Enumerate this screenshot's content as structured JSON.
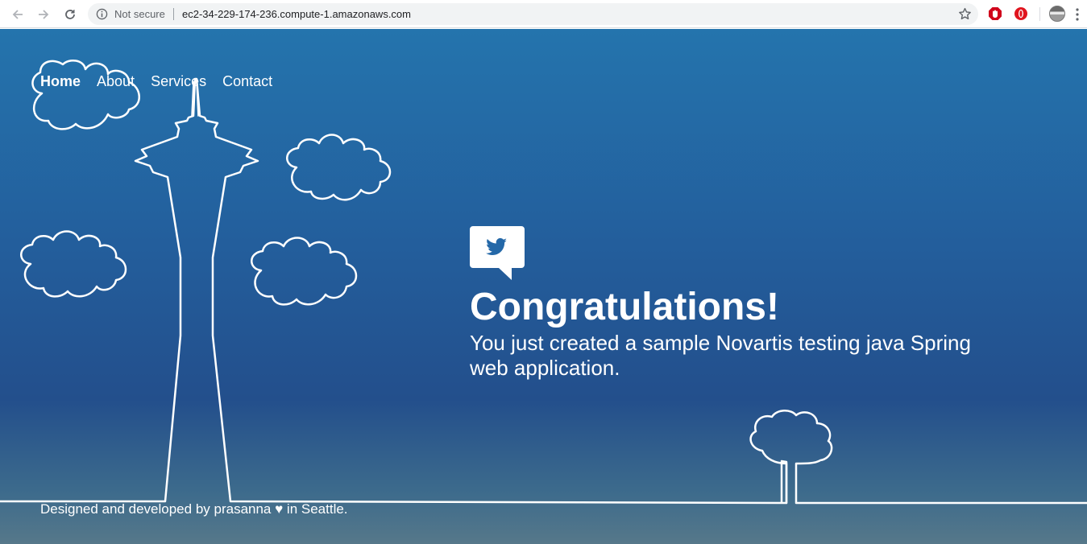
{
  "browser": {
    "security_label": "Not secure",
    "url": "ec2-34-229-174-236.compute-1.amazonaws.com",
    "icons": [
      "back-arrow-icon",
      "forward-arrow-icon",
      "reload-icon",
      "info-icon",
      "star-icon",
      "extension-stop-icon",
      "extension-opera-icon",
      "profile-avatar",
      "more-menu-icon"
    ]
  },
  "nav": {
    "items": [
      {
        "label": "Home",
        "active": true
      },
      {
        "label": "About"
      },
      {
        "label": "Services"
      },
      {
        "label": "Contact"
      }
    ]
  },
  "hero": {
    "icon": "twitter-bird-icon",
    "title": "Congratulations!",
    "subtitle": "You just created a sample Novartis testing java Spring web application."
  },
  "footer": {
    "text": "Designed and developed by prasanna ♥ in Seattle."
  },
  "colors": {
    "page_top": "#2474ad",
    "page_bottom": "#56788a",
    "line_art": "#ffffff",
    "twitter_blue": "#2468a8"
  }
}
